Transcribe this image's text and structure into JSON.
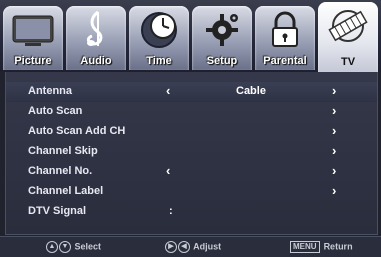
{
  "tabs": [
    {
      "label": "Picture",
      "icon": "tv-icon"
    },
    {
      "label": "Audio",
      "icon": "music-note-icon"
    },
    {
      "label": "Time",
      "icon": "clock-icon"
    },
    {
      "label": "Setup",
      "icon": "gear-icon"
    },
    {
      "label": "Parental",
      "icon": "lock-icon"
    },
    {
      "label": "TV",
      "icon": "film-icon"
    }
  ],
  "active_tab": "TV",
  "menu": {
    "antenna": {
      "label": "Antenna",
      "value": "Cable"
    },
    "auto_scan": {
      "label": "Auto Scan"
    },
    "auto_scan_add": {
      "label": "Auto Scan Add CH"
    },
    "channel_skip": {
      "label": "Channel Skip"
    },
    "channel_no": {
      "label": "Channel No."
    },
    "channel_label": {
      "label": "Channel Label"
    },
    "dtv_signal": {
      "label": "DTV Signal",
      "value": ":"
    }
  },
  "footer": {
    "select_label": "Select",
    "adjust_label": "Adjust",
    "menu_key": "MENU",
    "return_label": "Return"
  },
  "colors": {
    "accent": "#ffffff",
    "background": "#20232e"
  }
}
